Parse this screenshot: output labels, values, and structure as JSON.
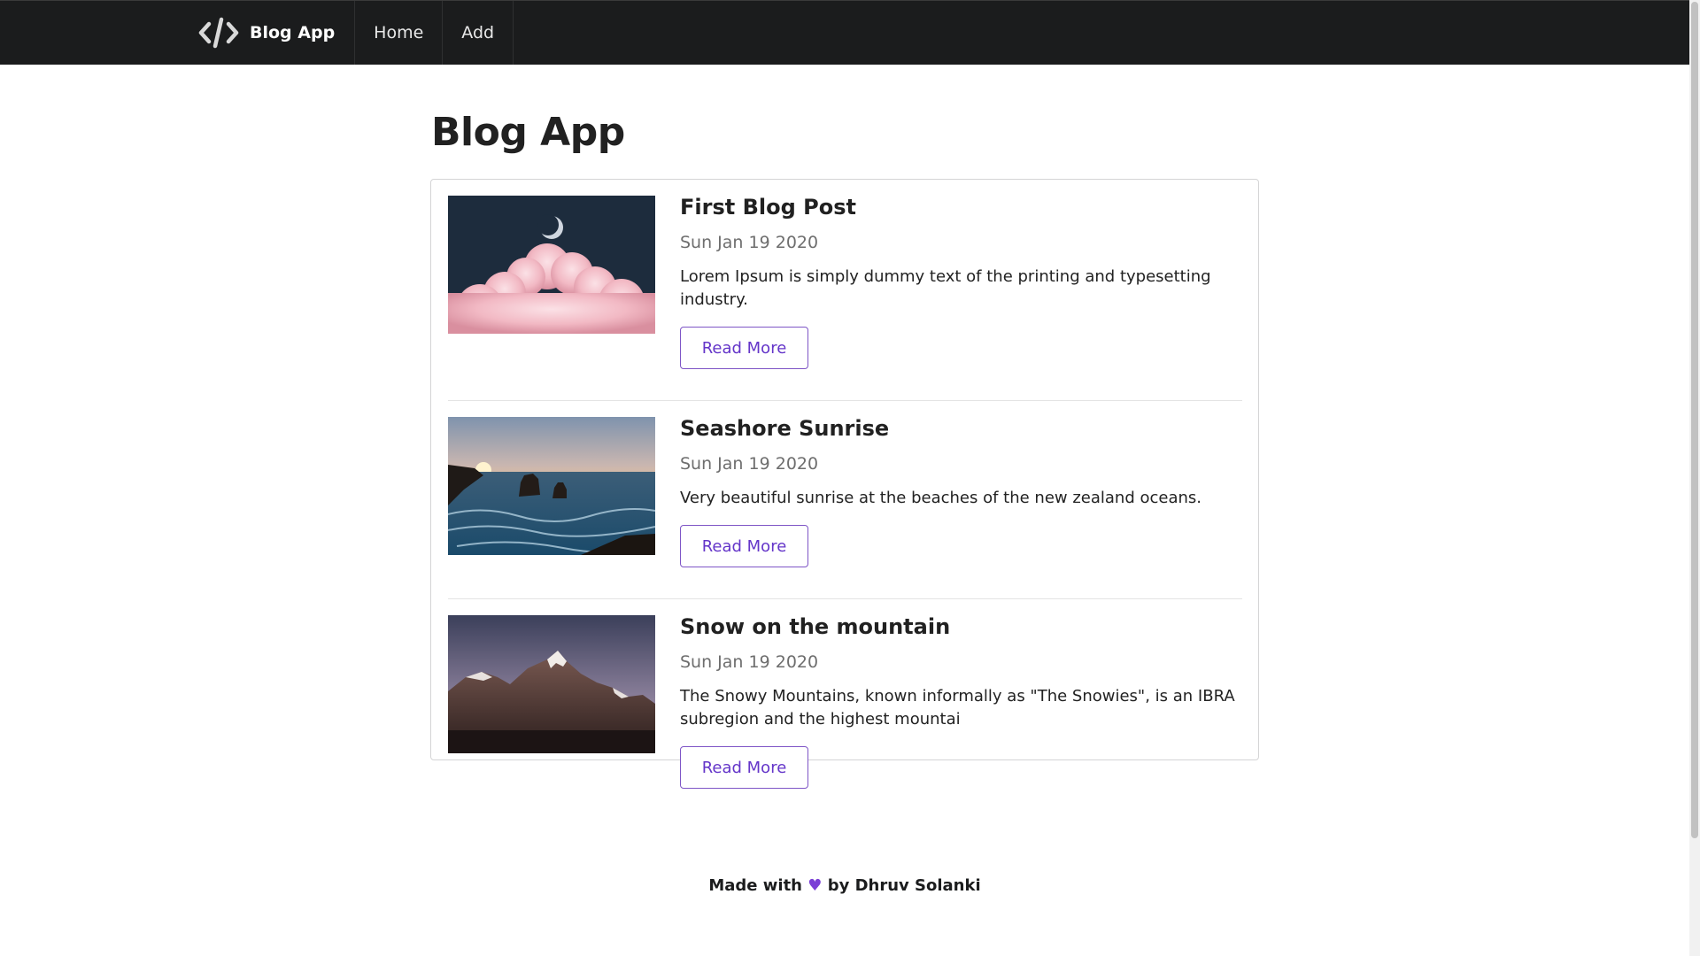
{
  "navbar": {
    "brand_icon": "code-icon",
    "brand_label": "Blog App",
    "items": [
      {
        "label": "Home"
      },
      {
        "label": "Add"
      }
    ]
  },
  "main": {
    "title": "Blog App",
    "posts": [
      {
        "title": "First Blog Post",
        "date": "Sun Jan 19 2020",
        "description": "Lorem Ipsum is simply dummy text of the printing and typesetting industry.",
        "button_label": "Read More",
        "image": "moon-over-pink-cloud-image"
      },
      {
        "title": "Seashore Sunrise",
        "date": "Sun Jan 19 2020",
        "description": "Very beautiful sunrise at the beaches of the new zealand oceans.",
        "button_label": "Read More",
        "image": "seashore-sunrise-image"
      },
      {
        "title": "Snow on the mountain",
        "date": "Sun Jan 19 2020",
        "description": "The Snowy Mountains, known informally as \"The Snowies\", is an IBRA subregion and the highest mountai",
        "button_label": "Read More",
        "image": "snowy-mountain-image"
      }
    ]
  },
  "footer": {
    "prefix": "Made with",
    "heart_icon": "heart-icon",
    "heart_glyph": "♥",
    "suffix": "by Dhruv Solanki"
  },
  "colors": {
    "navbar_bg": "#1b1c1d",
    "accent": "#6435c9",
    "heart": "#7a3ed6"
  }
}
